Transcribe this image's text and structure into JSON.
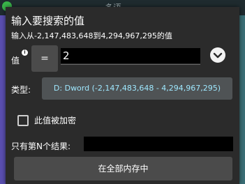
{
  "background": {
    "app_text": "多语..."
  },
  "dialog": {
    "title": "输入要搜索的值",
    "subtitle": "输入从-2,147,483,648到4,294,967,295的值",
    "value_label": "值",
    "info_icon": "i",
    "operator": "=",
    "value_input": "2",
    "type_label": "类型:",
    "type_value": "D: Dword (-2,147,483,648 - 4,294,967,295)",
    "encrypt_label": "此值被加密",
    "encrypt_checked": false,
    "nth_label": "只有第N个结果:",
    "nth_value": "",
    "search_button": "在全部内存中"
  },
  "colors": {
    "dialog_bg": "#2b2b2b",
    "button_bg": "#4b4b4b",
    "type_text": "#9fe8ff"
  }
}
